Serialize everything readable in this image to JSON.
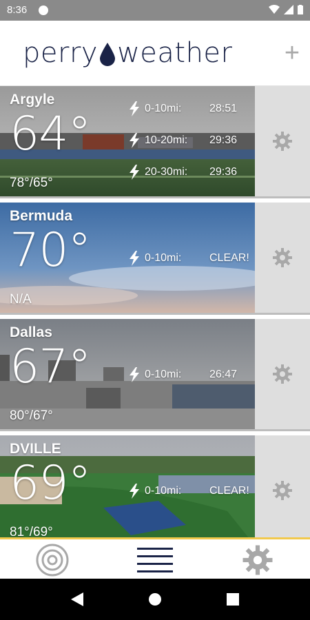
{
  "status_bar": {
    "time": "8:36"
  },
  "header": {
    "brand_left": "perry",
    "brand_right": "weather",
    "add_label": "+"
  },
  "colors": {
    "navy": "#1a2347",
    "gear": "#a8a8a8",
    "nav_accent": "#f2c94c"
  },
  "locations": [
    {
      "city": "Argyle",
      "temp": "64°",
      "hilo": "78°/65°",
      "strikes": [
        {
          "range": "0-10mi:",
          "time": "28:51"
        },
        {
          "range": "10-20mi:",
          "time": "29:36"
        },
        {
          "range": "20-30mi:",
          "time": "29:36"
        }
      ]
    },
    {
      "city": "Bermuda",
      "temp": "70°",
      "hilo": "N/A",
      "strikes": [
        {
          "range": "0-10mi:",
          "time": "CLEAR!"
        }
      ]
    },
    {
      "city": "Dallas",
      "temp": "67°",
      "hilo": "80°/67°",
      "strikes": [
        {
          "range": "0-10mi:",
          "time": "26:47"
        }
      ]
    },
    {
      "city": "DVILLE",
      "temp": "69°",
      "hilo": "81°/69°",
      "strikes": [
        {
          "range": "0-10mi:",
          "time": "CLEAR!"
        }
      ]
    }
  ],
  "bottom_nav": [
    {
      "name": "radar-icon"
    },
    {
      "name": "menu-icon"
    },
    {
      "name": "settings-icon"
    }
  ]
}
